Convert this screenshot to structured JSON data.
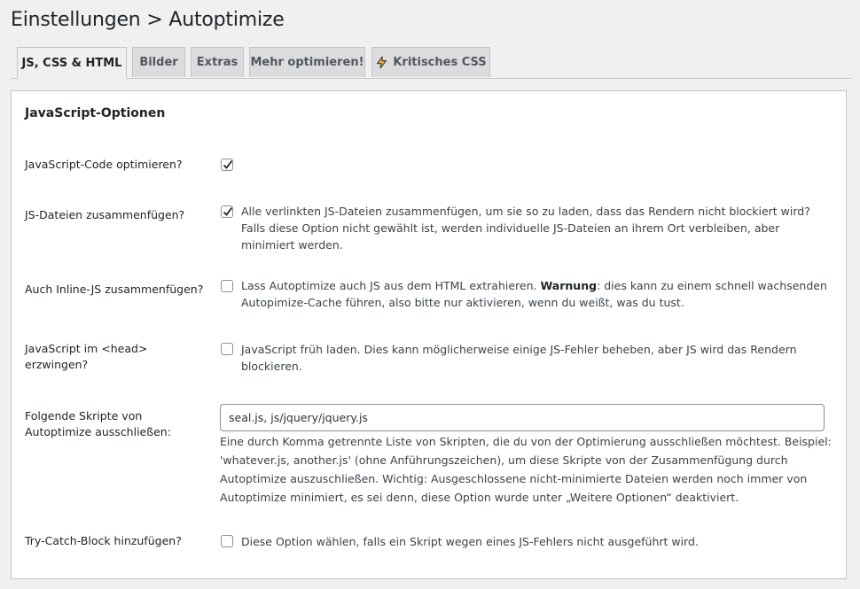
{
  "page": {
    "title": "Einstellungen > Autoptimize"
  },
  "tabs": [
    {
      "label": "JS, CSS & HTML",
      "active": true
    },
    {
      "label": "Bilder"
    },
    {
      "label": "Extras"
    },
    {
      "label": "Mehr optimieren!"
    },
    {
      "label": "Kritisches CSS",
      "icon": "lightning-icon"
    }
  ],
  "section": {
    "title": "JavaScript-Optionen"
  },
  "options": {
    "optimize_js": {
      "label": "JavaScript-Code optimieren?",
      "checked": true
    },
    "aggregate_js": {
      "label": "JS-Dateien zusammenfügen?",
      "checked": true,
      "description": "Alle verlinkten JS-Dateien zusammenfügen, um sie so zu laden, dass das Rendern nicht blockiert wird? Falls diese Option nicht gewählt ist, werden individuelle JS-Dateien an ihrem Ort verbleiben, aber minimiert werden."
    },
    "inline_js": {
      "label": "Auch Inline-JS zusammenfügen?",
      "checked": false,
      "description_pre": "Lass Autoptimize auch JS aus dem HTML extrahieren. ",
      "description_bold": "Warnung",
      "description_post": ": dies kann zu einem schnell wachsenden Autopimize-Cache führen, also bitte nur aktivieren, wenn du weißt, was du tust."
    },
    "force_head": {
      "label": "JavaScript im <head> erzwingen?",
      "checked": false,
      "description": "JavaScript früh laden. Dies kann möglicherweise einige JS-Fehler beheben, aber JS wird das Rendern blockieren."
    },
    "exclude_scripts": {
      "label": "Folgende Skripte von Autoptimize ausschließen:",
      "value": "seal.js, js/jquery/jquery.js",
      "help": "Eine durch Komma getrennte Liste von Skripten, die du von der Optimierung ausschließen möchtest. Beispiel: 'whatever.js, another.js' (ohne Anführungszeichen), um diese Skripte von der Zusammenfügung durch Autoptimize auszuschließen. Wichtig: Ausgeschlossene nicht-minimierte Dateien werden noch immer von Autoptimize minimiert, es sei denn, diese Option wurde unter „Weitere Optionen“ deaktiviert."
    },
    "try_catch": {
      "label": "Try-Catch-Block hinzufügen?",
      "checked": false,
      "description": "Diese Option wählen, falls ein Skript wegen eines JS-Fehlers nicht ausgeführt wird."
    }
  },
  "colors": {
    "accent": "#2271b1",
    "lightning": "#e3a008"
  }
}
